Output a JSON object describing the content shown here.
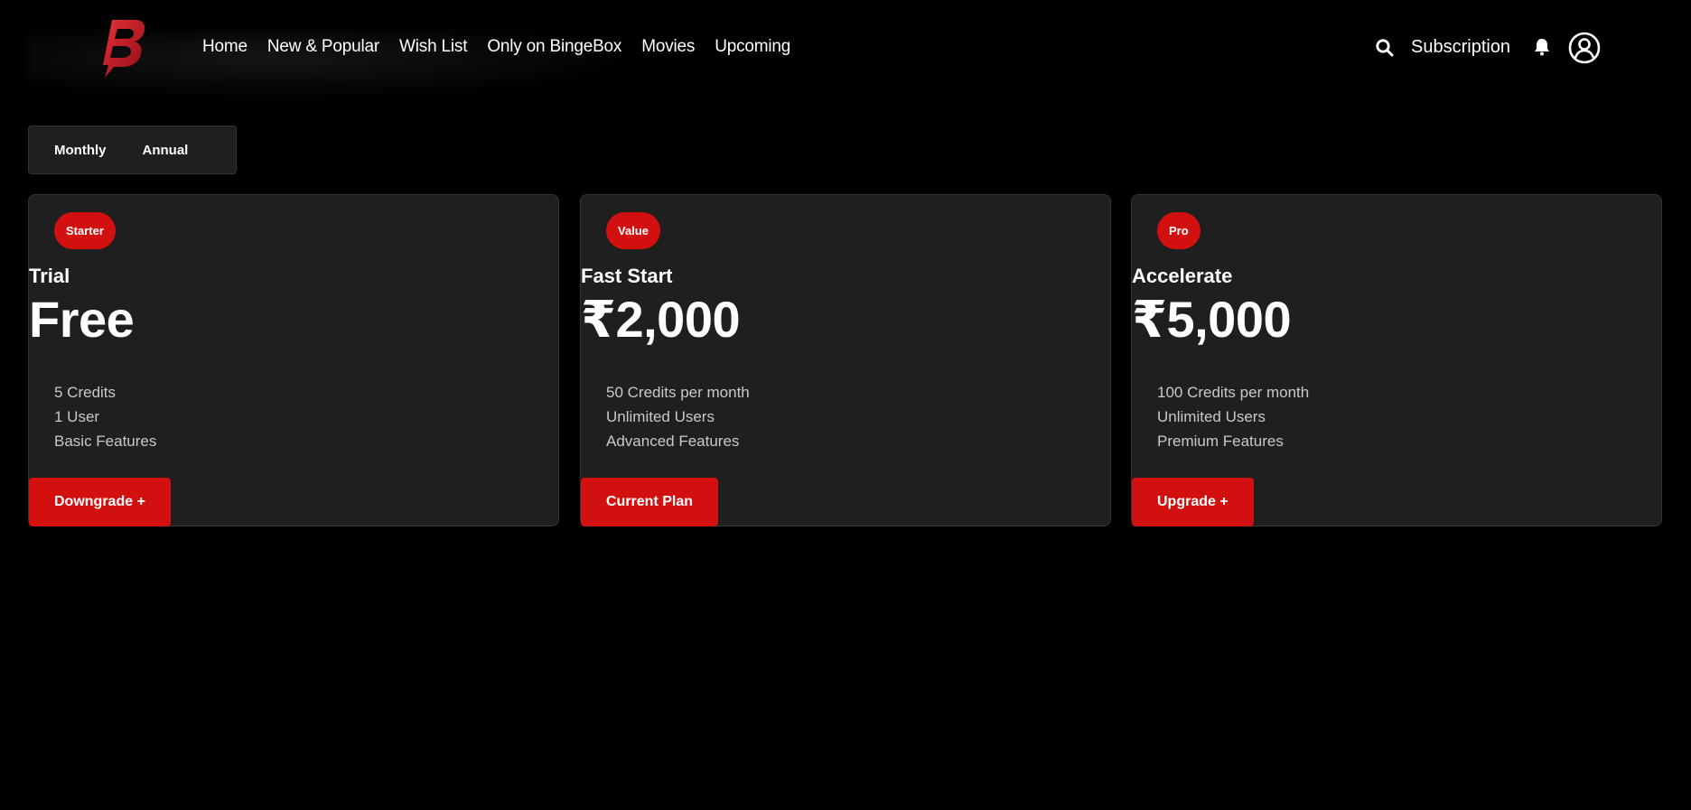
{
  "brand": {
    "logo_letter": "B",
    "accent_color": "#d31010"
  },
  "nav": {
    "items": [
      {
        "label": "Home"
      },
      {
        "label": "New & Popular"
      },
      {
        "label": "Wish List"
      },
      {
        "label": "Only on BingeBox"
      },
      {
        "label": "Movies"
      },
      {
        "label": "Upcoming"
      }
    ]
  },
  "header_right": {
    "search_icon": "search-icon",
    "subscription_label": "Subscription",
    "bell_icon": "bell-icon",
    "avatar_icon": "user-circle-icon"
  },
  "billing_toggle": {
    "options": [
      "Monthly",
      "Annual"
    ]
  },
  "plans": [
    {
      "badge": "Starter",
      "name": "Trial",
      "price": "Free",
      "features": [
        "5 Credits",
        "1 User",
        "Basic Features"
      ],
      "button_label": "Downgrade +"
    },
    {
      "badge": "Value",
      "name": "Fast Start",
      "price": "₹2,000",
      "features": [
        "50 Credits per month",
        "Unlimited Users",
        "Advanced Features"
      ],
      "button_label": "Current Plan"
    },
    {
      "badge": "Pro",
      "name": "Accelerate",
      "price": "₹5,000",
      "features": [
        "100 Credits per month",
        "Unlimited Users",
        "Premium Features"
      ],
      "button_label": "Upgrade +"
    }
  ]
}
